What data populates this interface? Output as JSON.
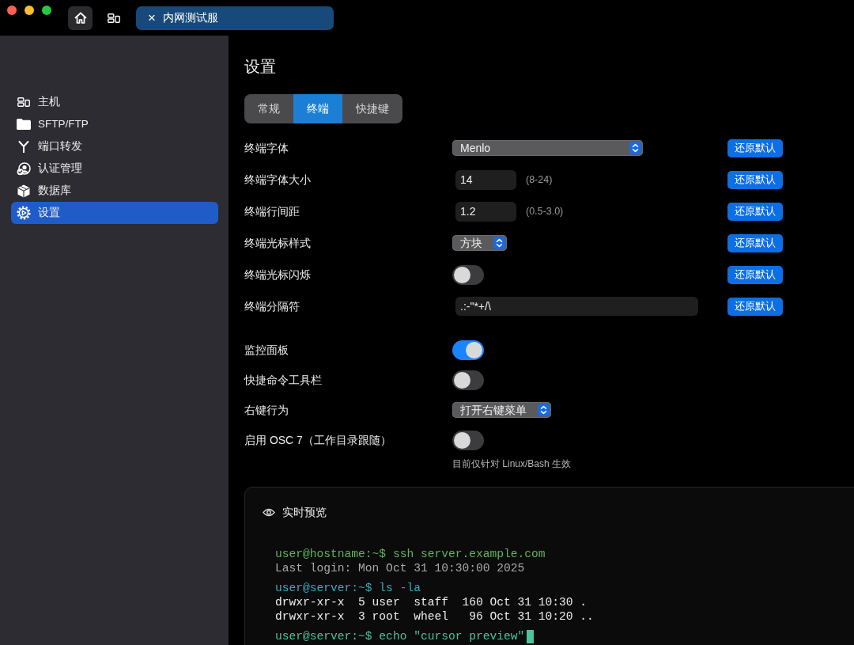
{
  "window": {
    "traffic_lights": [
      {
        "color": "#ff5f57"
      },
      {
        "color": "#febc2e"
      },
      {
        "color": "#28c840"
      }
    ],
    "toolbar": [
      {
        "kind": "home",
        "selected": true
      },
      {
        "kind": "hosts",
        "selected": false
      }
    ],
    "tabs": [
      {
        "close": "×",
        "title": "内网测试服",
        "selected": true
      }
    ]
  },
  "sidebar": {
    "items": [
      {
        "kind": "hosts",
        "label": "主机",
        "selected": false
      },
      {
        "kind": "folder",
        "label": "SFTP/FTP",
        "selected": false
      },
      {
        "kind": "fork",
        "label": "端口转发",
        "selected": false
      },
      {
        "kind": "auth",
        "label": "认证管理",
        "selected": false
      },
      {
        "kind": "database",
        "label": "数据库",
        "selected": false
      },
      {
        "kind": "settings",
        "label": "设置",
        "selected": true
      }
    ]
  },
  "settings": {
    "title": "设置",
    "tabs": [
      {
        "label": "常规",
        "selected": false
      },
      {
        "label": "终端",
        "selected": true
      },
      {
        "label": "快捷键",
        "selected": false
      }
    ],
    "groups": [
      {
        "rows": [
          {
            "kind": "select",
            "label": "终端字体",
            "value": "Menlo",
            "reset": "还原默认"
          },
          {
            "kind": "number",
            "label": "终端字体大小",
            "value": "14",
            "hint": "(8-24)",
            "reset": "还原默认"
          },
          {
            "kind": "number",
            "label": "终端行间距",
            "value": "1.2",
            "hint": "(0.5-3.0)",
            "reset": "还原默认"
          },
          {
            "kind": "select",
            "label": "终端光标样式",
            "value": "方块",
            "reset": "还原默认"
          },
          {
            "kind": "toggle",
            "label": "终端光标闪烁",
            "on": false,
            "reset": "还原默认"
          },
          {
            "kind": "text",
            "label": "终端分隔符",
            "value": ".:-\"*+/\\",
            "reset": "还原默认"
          }
        ]
      },
      {
        "rows": [
          {
            "kind": "toggle",
            "label": "监控面板",
            "on": true
          },
          {
            "kind": "toggle",
            "label": "快捷命令工具栏",
            "on": false
          },
          {
            "kind": "select",
            "label": "右键行为",
            "value": "打开右键菜单"
          },
          {
            "kind": "toggle",
            "label": "启用 OSC 7（工作目录跟随）",
            "on": false,
            "note": "目前仅针对 Linux/Bash 生效"
          }
        ]
      }
    ]
  },
  "preview": {
    "title": "实时预览",
    "blocks": [
      {
        "lines": [
          {
            "text": "user@hostname:~$ ssh server.example.com",
            "color": "#5fb35c",
            "cursor": false
          },
          {
            "text": "Last login: Mon Oct 31 10:30:00 2025",
            "color": "#a9a9a9",
            "cursor": false
          }
        ]
      },
      {
        "lines": [
          {
            "text": "user@server:~$ ls -la",
            "color": "#3aa9bf",
            "cursor": false
          },
          {
            "text": "drwxr-xr-x  5 user  staff  160 Oct 31 10:30 .",
            "color": "#ececec",
            "cursor": false
          },
          {
            "text": "drwxr-xr-x  3 root  wheel   96 Oct 31 10:20 ..",
            "color": "#ececec",
            "cursor": false
          }
        ]
      },
      {
        "lines": [
          {
            "text": "user@server:~$ echo \"cursor preview\"",
            "color": "#4cc39a",
            "cursor": true
          }
        ]
      }
    ]
  }
}
